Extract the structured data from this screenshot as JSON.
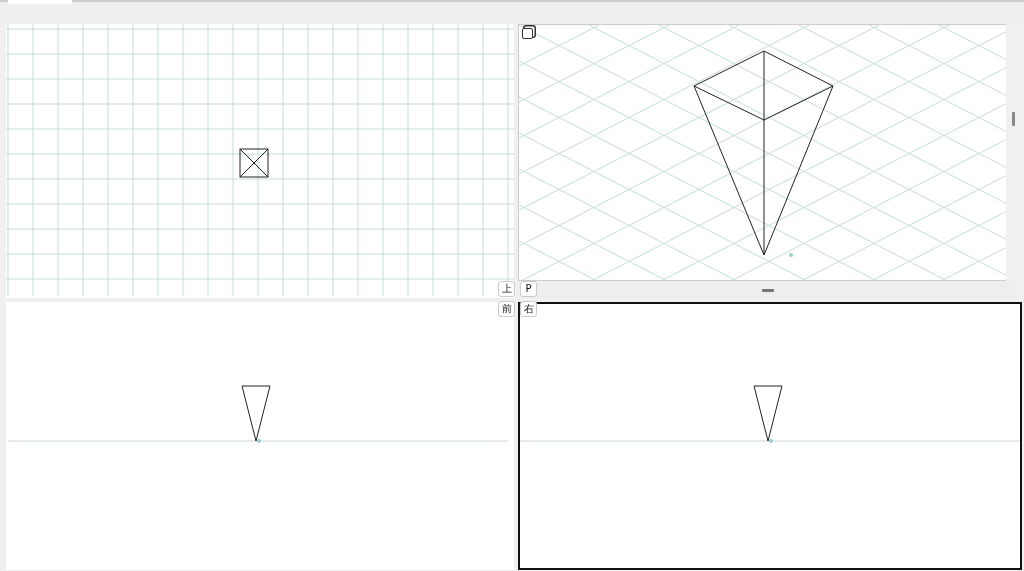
{
  "viewports": [
    {
      "kind": "top",
      "label": "上",
      "selected": false
    },
    {
      "kind": "perspective",
      "label": "P",
      "selected": false
    },
    {
      "kind": "front",
      "label": "前",
      "selected": false
    },
    {
      "kind": "side",
      "label": "右",
      "selected": true
    }
  ]
}
